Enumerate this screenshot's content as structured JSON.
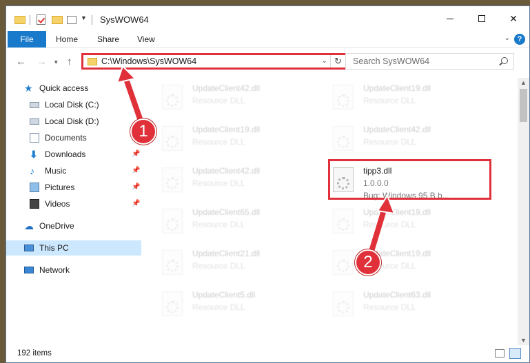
{
  "window": {
    "title": "SysWOW64"
  },
  "ribbon": {
    "tabs": [
      "File",
      "Home",
      "Share",
      "View"
    ],
    "help": "?"
  },
  "address": {
    "path": "C:\\Windows\\SysWOW64",
    "search_placeholder": "Search SysWOW64"
  },
  "nav": {
    "quick_access": "Quick access",
    "items": [
      {
        "label": "Local Disk (C:)",
        "icon": "drive-icon",
        "pinned": false
      },
      {
        "label": "Local Disk (D:)",
        "icon": "drive-icon",
        "pinned": false
      },
      {
        "label": "Documents",
        "icon": "documents-icon",
        "pinned": true
      },
      {
        "label": "Downloads",
        "icon": "downloads-icon",
        "pinned": true
      },
      {
        "label": "Music",
        "icon": "music-icon",
        "pinned": true
      },
      {
        "label": "Pictures",
        "icon": "pictures-icon",
        "pinned": true
      },
      {
        "label": "Videos",
        "icon": "videos-icon",
        "pinned": true
      }
    ],
    "onedrive": "OneDrive",
    "this_pc": "This PC",
    "network": "Network"
  },
  "files": {
    "left": [
      {
        "name": "UpdateClient42.dll",
        "desc": "Resource DLL"
      },
      {
        "name": "UpdateClient19.dll",
        "desc": "Resource DLL"
      },
      {
        "name": "UpdateClient42.dll",
        "desc": "Resource DLL"
      },
      {
        "name": "UpdateClient65.dll",
        "desc": "Resource DLL"
      },
      {
        "name": "UpdateClient21.dll",
        "desc": "Resource DLL"
      },
      {
        "name": "UpdateClient5.dll",
        "desc": "Resource DLL"
      }
    ],
    "right": [
      {
        "name": "UpdateClient19.dll",
        "desc": "Resource DLL"
      },
      {
        "name": "UpdateClient42.dll",
        "desc": "Resource DLL"
      },
      {
        "name": "UpdateClient19.dll",
        "desc": "Resource DLL"
      },
      {
        "name": "UpdateClient19.dll",
        "desc": "Resource DLL"
      },
      {
        "name": "UpdateClient63.dll",
        "desc": "Resource DLL"
      }
    ],
    "highlighted": {
      "name": "tipp3.dll",
      "version": "1.0.0.0",
      "desc": "Bug: Windows 95 B b..."
    }
  },
  "status": {
    "count": "192 items"
  },
  "annotations": {
    "step1": "1",
    "step2": "2",
    "color": "#e0313b"
  }
}
